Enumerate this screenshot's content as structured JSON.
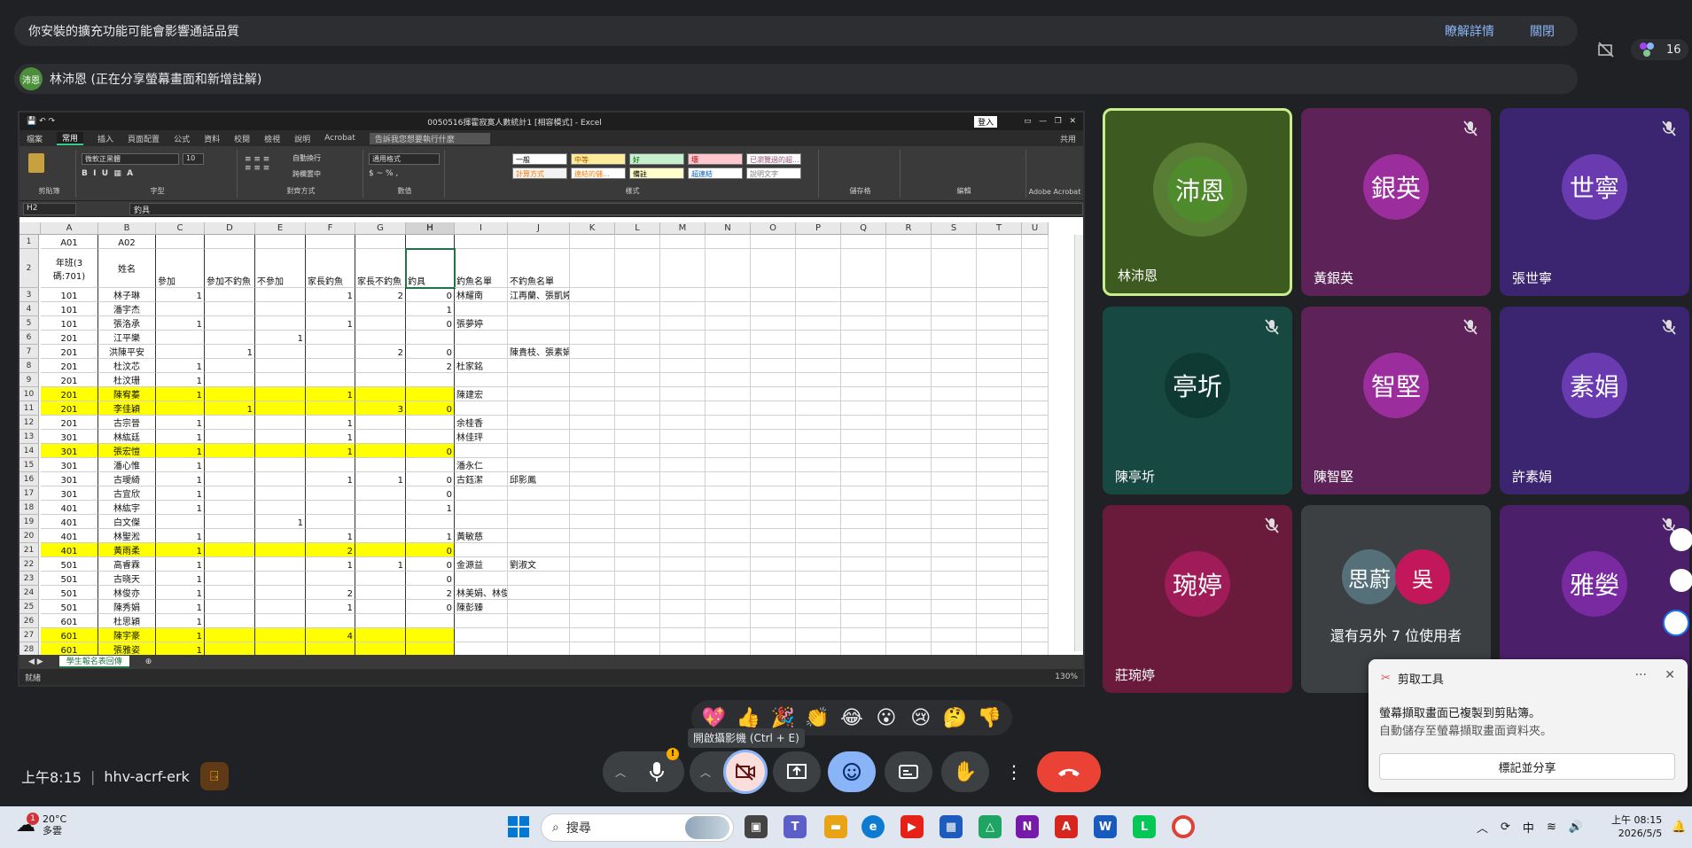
{
  "warning": {
    "message": "你安裝的擴充功能可能會影響通話品質",
    "details": "瞭解詳情",
    "close": "關閉"
  },
  "share": {
    "avatar": "沛恩",
    "text": "林沛恩 (正在分享螢幕畫面和新增註解)"
  },
  "top_right": {
    "participant_count": "16"
  },
  "excel": {
    "title": "0050516揮霍寂寞人數統計1 [相容模式] - Excel",
    "login": "登入",
    "tabs": [
      "檔案",
      "常用",
      "插入",
      "頁面配置",
      "公式",
      "資料",
      "校閱",
      "檢視",
      "說明",
      "Acrobat"
    ],
    "search": "告訴我您想要執行什麼",
    "share": "共用",
    "ribbon_groups": [
      "剪貼簿",
      "字型",
      "對齊方式",
      "數值",
      "樣式",
      "儲存格",
      "編輯",
      "Adobe Acrobat"
    ],
    "font": "微軟正黑體",
    "font_size": "10",
    "number_format": "通用格式",
    "auto_wrap": "自動換行",
    "merge": "跨欄置中",
    "styles": {
      "normal": "一般",
      "neutral": "中等",
      "good": "好",
      "bad": "壞",
      "prev": "已瀏覽過的超...",
      "calc": "計算方式",
      "linked": "連結的儲...",
      "note": "備註",
      "hyperlink": "超連結",
      "explain": "說明文字"
    },
    "name_box": "H2",
    "formula": "釣具",
    "columns": [
      "A",
      "B",
      "C",
      "D",
      "E",
      "F",
      "G",
      "H",
      "I",
      "J",
      "K",
      "L",
      "M",
      "N",
      "O",
      "P",
      "Q",
      "R",
      "S",
      "T",
      "U"
    ],
    "rows": [
      {
        "n": "1",
        "cells": [
          "A01",
          "A02",
          "",
          "",
          "",
          "",
          "",
          "",
          "",
          ""
        ],
        "y": false
      },
      {
        "n": "2",
        "cells": [
          "年班(3碼:701)",
          "姓名",
          "參加",
          "參加不釣魚",
          "不參加",
          "家長釣魚",
          "家長不釣魚",
          "釣具",
          "釣魚名單",
          "不釣魚名單"
        ],
        "y": false
      },
      {
        "n": "3",
        "cells": [
          "101",
          "林子琳",
          "1",
          "",
          "",
          "1",
          "2",
          "0",
          "林耀南",
          "江再蘭、張凱婷"
        ],
        "y": false
      },
      {
        "n": "4",
        "cells": [
          "101",
          "潘宇杰",
          "",
          "",
          "",
          "",
          "",
          "1",
          "",
          ""
        ],
        "y": false
      },
      {
        "n": "5",
        "cells": [
          "101",
          "張洛承",
          "1",
          "",
          "",
          "1",
          "",
          "0",
          "張夢婷",
          ""
        ],
        "y": false
      },
      {
        "n": "6",
        "cells": [
          "201",
          "江平樂",
          "",
          "",
          "1",
          "",
          "",
          "",
          "",
          ""
        ],
        "y": false
      },
      {
        "n": "7",
        "cells": [
          "201",
          "洪陳平安",
          "",
          "1",
          "",
          "",
          "2",
          "0",
          "",
          "陳貴枝、張素娟"
        ],
        "y": false
      },
      {
        "n": "8",
        "cells": [
          "201",
          "杜汶芯",
          "1",
          "",
          "",
          "",
          "",
          "2",
          "杜家銘",
          ""
        ],
        "y": false
      },
      {
        "n": "9",
        "cells": [
          "201",
          "杜汶珊",
          "1",
          "",
          "",
          "",
          "",
          "",
          "",
          ""
        ],
        "y": false
      },
      {
        "n": "10",
        "cells": [
          "201",
          "陳宥蓁",
          "1",
          "",
          "",
          "1",
          "",
          "",
          "陳建宏",
          ""
        ],
        "y": true
      },
      {
        "n": "11",
        "cells": [
          "201",
          "李佳穎",
          "",
          "1",
          "",
          "",
          "3",
          "0",
          "",
          ""
        ],
        "y": true
      },
      {
        "n": "12",
        "cells": [
          "201",
          "古宗晉",
          "1",
          "",
          "",
          "1",
          "",
          "",
          "余桂香",
          ""
        ],
        "y": false
      },
      {
        "n": "13",
        "cells": [
          "301",
          "林紘廷",
          "1",
          "",
          "",
          "1",
          "",
          "",
          "林佳玶",
          ""
        ],
        "y": false
      },
      {
        "n": "14",
        "cells": [
          "301",
          "張宏愷",
          "1",
          "",
          "",
          "1",
          "",
          "0",
          "",
          ""
        ],
        "y": true
      },
      {
        "n": "15",
        "cells": [
          "301",
          "潘心惟",
          "1",
          "",
          "",
          "",
          "",
          "",
          "潘永仁",
          ""
        ],
        "y": false
      },
      {
        "n": "16",
        "cells": [
          "301",
          "古璦綺",
          "1",
          "",
          "",
          "1",
          "1",
          "0",
          "古鈺潔",
          "邱影鳳"
        ],
        "y": false
      },
      {
        "n": "17",
        "cells": [
          "301",
          "古宜欣",
          "1",
          "",
          "",
          "",
          "",
          "0",
          "",
          ""
        ],
        "y": false
      },
      {
        "n": "18",
        "cells": [
          "401",
          "林紘宇",
          "1",
          "",
          "",
          "",
          "",
          "1",
          "",
          ""
        ],
        "y": false
      },
      {
        "n": "19",
        "cells": [
          "401",
          "白文傑",
          "",
          "",
          "1",
          "",
          "",
          "",
          "",
          ""
        ],
        "y": false
      },
      {
        "n": "20",
        "cells": [
          "401",
          "林聖淞",
          "1",
          "",
          "",
          "1",
          "",
          "1",
          "黃敏慈",
          ""
        ],
        "y": false
      },
      {
        "n": "21",
        "cells": [
          "401",
          "黃雨柔",
          "1",
          "",
          "",
          "2",
          "",
          "0",
          "",
          ""
        ],
        "y": true
      },
      {
        "n": "22",
        "cells": [
          "501",
          "高睿霖",
          "1",
          "",
          "",
          "1",
          "1",
          "0",
          "金源益",
          "劉淑文"
        ],
        "y": false
      },
      {
        "n": "23",
        "cells": [
          "501",
          "古晓天",
          "1",
          "",
          "",
          "",
          "",
          "0",
          "",
          ""
        ],
        "y": false
      },
      {
        "n": "24",
        "cells": [
          "501",
          "林俊亦",
          "1",
          "",
          "",
          "2",
          "",
          "2",
          "林美娟、林俊維",
          ""
        ],
        "y": false
      },
      {
        "n": "25",
        "cells": [
          "501",
          "陳秀娟",
          "1",
          "",
          "",
          "1",
          "",
          "0",
          "陳彭臻",
          ""
        ],
        "y": false
      },
      {
        "n": "26",
        "cells": [
          "601",
          "杜思穎",
          "1",
          "",
          "",
          "",
          "",
          "",
          "",
          ""
        ],
        "y": false
      },
      {
        "n": "27",
        "cells": [
          "601",
          "陳宇豪",
          "1",
          "",
          "",
          "4",
          "",
          "",
          "",
          ""
        ],
        "y": true
      },
      {
        "n": "28",
        "cells": [
          "601",
          "張雅姿",
          "1",
          "",
          "",
          "",
          "",
          "",
          "",
          ""
        ],
        "y": true
      }
    ],
    "sheet_tab": "學生報名表回傳",
    "status": "就緒",
    "zoom": "130%"
  },
  "tiles": [
    {
      "name": "林沛恩",
      "avatar": "沛恩",
      "bg": "#3d5a21",
      "av_bg": "#4f8a2c",
      "muted": false
    },
    {
      "name": "黃銀英",
      "avatar": "銀英",
      "bg": "#5d2258",
      "av_bg": "#9b2e9c",
      "muted": true
    },
    {
      "name": "張世寧",
      "avatar": "世寧",
      "bg": "#3b2470",
      "av_bg": "#6a3bb0",
      "muted": true
    },
    {
      "name": "陳亭圻",
      "avatar": "亭圻",
      "bg": "#184842",
      "av_bg": "#0f3a34",
      "muted": true
    },
    {
      "name": "陳智堅",
      "avatar": "智堅",
      "bg": "#5d2258",
      "av_bg": "#9b2e9c",
      "muted": true
    },
    {
      "name": "許素娟",
      "avatar": "素娟",
      "bg": "#3b2470",
      "av_bg": "#6a3bb0",
      "muted": true
    },
    {
      "name": "莊琬婷",
      "avatar": "琬婷",
      "bg": "#6a1b3c",
      "av_bg": "#a01c58",
      "muted": true
    },
    {
      "name": "還有另外 7 位使用者",
      "avatar": "",
      "bg": "#3c4043",
      "av_bg": "",
      "muted": false
    },
    {
      "name": "",
      "avatar": "雅嫈",
      "bg": "#4b1f6a",
      "av_bg": "#7a2aa0",
      "muted": true
    }
  ],
  "others": {
    "a1": "思蔚",
    "a2": "吳"
  },
  "snip": {
    "app": "剪取工具",
    "line1": "螢幕擷取畫面已複製到剪貼簿。",
    "line2": "自動儲存至螢幕擷取畫面資料夾。",
    "button": "標記並分享"
  },
  "reactions": [
    "💖",
    "👍",
    "🎉",
    "👏",
    "😂",
    "😮",
    "😢",
    "🤔",
    "👎"
  ],
  "tooltip": "開啟攝影機 (Ctrl + E)",
  "meet": {
    "time": "上午8:15",
    "separator": "|",
    "code": "hhv-acrf-erk"
  },
  "taskbar": {
    "weather_temp": "20°C",
    "weather_desc": "多雲",
    "weather_badge": "1",
    "search": "搜尋",
    "ime": "中",
    "time": "上午 08:15",
    "date": "2026/5/5"
  }
}
